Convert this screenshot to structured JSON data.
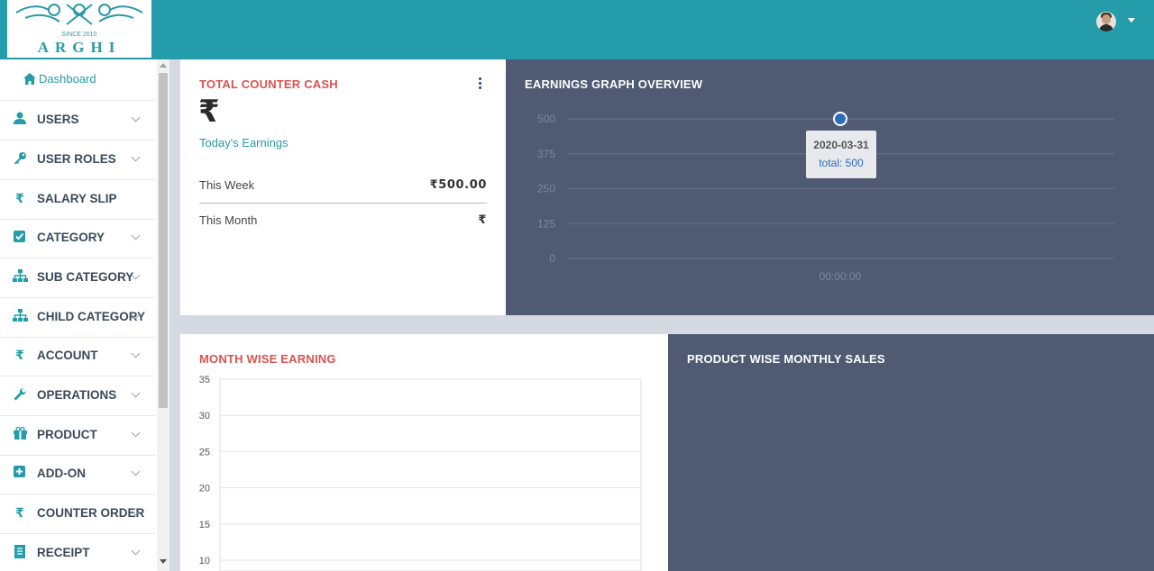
{
  "brand": {
    "logo_text": "ARGHI",
    "logo_subtext": "SINCE 2010"
  },
  "sidebar": {
    "dashboard_label": "Dashboard",
    "items": [
      {
        "label": "USERS",
        "icon": "user-icon",
        "expandable": true
      },
      {
        "label": "USER ROLES",
        "icon": "key-icon",
        "expandable": true
      },
      {
        "label": "SALARY SLIP",
        "icon": "rupee-icon",
        "expandable": false
      },
      {
        "label": "CATEGORY",
        "icon": "checkbox-icon",
        "expandable": true
      },
      {
        "label": "SUB CATEGORY",
        "icon": "sitemap-icon",
        "expandable": true
      },
      {
        "label": "CHILD CATEGORY",
        "icon": "sitemap-icon",
        "expandable": true
      },
      {
        "label": "ACCOUNT",
        "icon": "rupee-icon",
        "expandable": true
      },
      {
        "label": "OPERATIONS",
        "icon": "wrench-icon",
        "expandable": true
      },
      {
        "label": "PRODUCT",
        "icon": "gift-icon",
        "expandable": true
      },
      {
        "label": "ADD-ON",
        "icon": "plus-square-icon",
        "expandable": true
      },
      {
        "label": "COUNTER ORDER",
        "icon": "rupee-icon",
        "expandable": true
      },
      {
        "label": "RECEIPT",
        "icon": "receipt-icon",
        "expandable": true
      }
    ]
  },
  "counter_cash": {
    "title": "TOTAL COUNTER CASH",
    "currency_symbol": "₹",
    "subtitle": "Today's Earnings",
    "rows": [
      {
        "label": "This Week",
        "value": "₹500.00"
      },
      {
        "label": "This Month",
        "value": "₹"
      }
    ]
  },
  "earnings_graph": {
    "title": "EARNINGS GRAPH OVERVIEW",
    "tooltip": {
      "date": "2020-03-31",
      "text": "total: 500"
    }
  },
  "month_wise": {
    "title": "MONTH WISE EARNING"
  },
  "product_sales": {
    "title": "PRODUCT WISE MONTHLY SALES"
  },
  "colors": {
    "topbar": "#259ca9",
    "dark_card": "#505a72",
    "red_title": "#d9534f",
    "accent": "#259ca9"
  },
  "chart_data": [
    {
      "type": "line",
      "x": [
        "00:00:00"
      ],
      "series": [
        {
          "values": [
            500
          ]
        }
      ],
      "y_ticks": [
        "500",
        "375",
        "250",
        "125",
        "0"
      ],
      "ylim": [
        0,
        500
      ],
      "grid": true
    },
    {
      "type": "bar",
      "y_ticks": [
        "35",
        "30",
        "25",
        "20",
        "15",
        "10"
      ],
      "ylim": [
        10,
        35
      ],
      "grid": true
    }
  ]
}
